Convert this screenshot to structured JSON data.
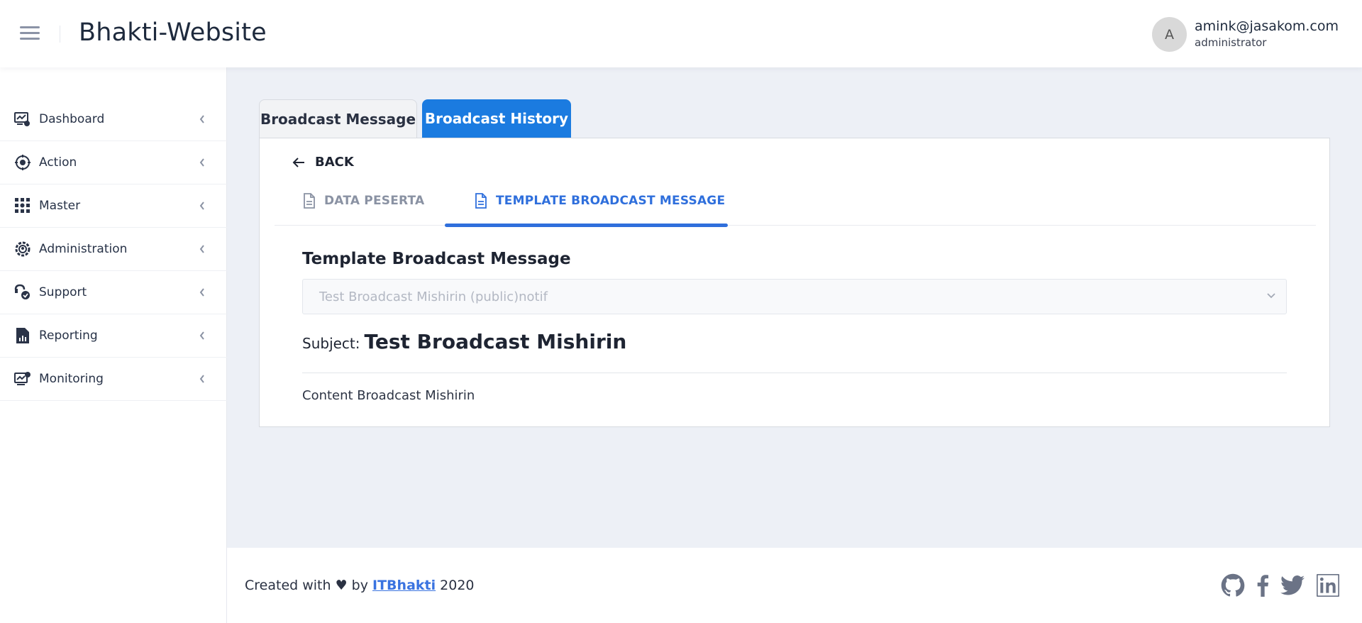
{
  "header": {
    "title": "Bhakti-Website",
    "avatar_initial": "A",
    "user_email": "amink@jasakom.com",
    "user_role": "administrator"
  },
  "sidebar": {
    "items": [
      {
        "label": "Dashboard",
        "icon": "dashboard-icon"
      },
      {
        "label": "Action",
        "icon": "action-icon"
      },
      {
        "label": "Master",
        "icon": "master-grid-icon"
      },
      {
        "label": "Administration",
        "icon": "gear-icon"
      },
      {
        "label": "Support",
        "icon": "support-icon"
      },
      {
        "label": "Reporting",
        "icon": "report-icon"
      },
      {
        "label": "Monitoring",
        "icon": "monitoring-icon"
      }
    ]
  },
  "tabs": {
    "broadcast_message": "Broadcast Message",
    "broadcast_history": "Broadcast History",
    "active": "broadcast_history"
  },
  "back_label": "BACK",
  "subtabs": {
    "data_peserta": "DATA PESERTA",
    "template_broadcast": "TEMPLATE BROADCAST MESSAGE",
    "active": "template_broadcast"
  },
  "template": {
    "title": "Template Broadcast Message",
    "selected_option": "Test Broadcast Mishirin (public)notif",
    "subject_label": "Subject:",
    "subject_value": "Test Broadcast Mishirin",
    "content": "Content Broadcast Mishirin"
  },
  "footer": {
    "prefix": "Created with ",
    "heart": "♥",
    "by": " by ",
    "link": "ITBhakti",
    "year": " 2020"
  },
  "colors": {
    "accent": "#1b7be0",
    "subtab_active": "#2f6fdc",
    "background": "#edf0f6"
  }
}
